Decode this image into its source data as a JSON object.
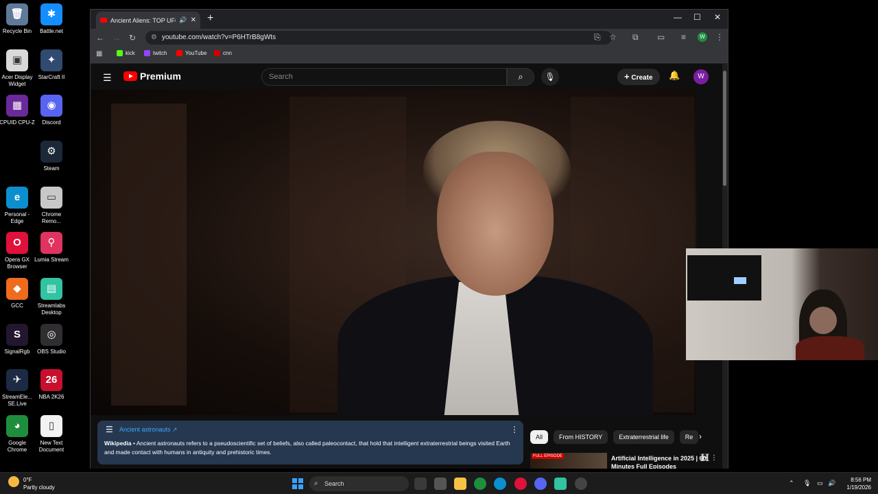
{
  "desktop": {
    "icons": [
      {
        "label": "Recycle Bin",
        "glyph": "🗑",
        "color": "#5f7a99"
      },
      {
        "label": "Battle.net",
        "glyph": "✱",
        "color": "#148eff"
      },
      {
        "label": "Acer Display Widget",
        "glyph": "▣",
        "color": "#d9d9d9"
      },
      {
        "label": "StarCraft II",
        "glyph": "✦",
        "color": "#304a70"
      },
      {
        "label": "CPUID CPU-Z",
        "glyph": "▦",
        "color": "#6a2a9a"
      },
      {
        "label": "Discord",
        "glyph": "◉",
        "color": "#5865f2"
      },
      {
        "label": "Steam",
        "glyph": "⚙",
        "color": "#1b2838"
      },
      {
        "label": "Personal - Edge",
        "glyph": "e",
        "color": "#0c8fce"
      },
      {
        "label": "Chrome Remo...",
        "glyph": "▭",
        "color": "#c8c8c8"
      },
      {
        "label": "Opera GX Browser",
        "glyph": "O",
        "color": "#e0113b"
      },
      {
        "label": "Lumia Stream",
        "glyph": "⚲",
        "color": "#e0335f"
      },
      {
        "label": "GCC",
        "glyph": "◆",
        "color": "#ef6b1d"
      },
      {
        "label": "Streamlabs Desktop",
        "glyph": "▤",
        "color": "#31c3a2"
      },
      {
        "label": "SignalRgb",
        "glyph": "S",
        "color": "#22172e"
      },
      {
        "label": "OBS Studio",
        "glyph": "◎",
        "color": "#302e31"
      },
      {
        "label": "StreamEle... SE.Live",
        "glyph": "✈",
        "color": "#1c2a44"
      },
      {
        "label": "NBA 2K26",
        "glyph": "26",
        "color": "#c8102e"
      },
      {
        "label": "Google Chrome",
        "glyph": "◕",
        "color": "#1e8e3e"
      },
      {
        "label": "New Text Document",
        "glyph": "▯",
        "color": "#f2f2f2"
      }
    ]
  },
  "browser": {
    "tab_title": "Ancient Aliens: TOP UFO M",
    "new_tab": "+",
    "url": "youtube.com/watch?v=P6HTrB8gWts",
    "profile_initial": "W",
    "bookmarks": [
      {
        "label": "kick",
        "color": "#53fc18"
      },
      {
        "label": "twitch",
        "color": "#9146ff"
      },
      {
        "label": "YouTube",
        "color": "#ff0000"
      },
      {
        "label": "cnn",
        "color": "#cc0000"
      }
    ]
  },
  "youtube": {
    "logo_text": "Premium",
    "search_placeholder": "Search",
    "create_label": "Create",
    "avatar_initial": "W",
    "watermark": "H",
    "info_panel": {
      "title": "Ancient astronauts ↗",
      "source": "Wikipedia",
      "text": " • Ancient astronauts refers to a pseudoscientific set of beliefs, also called paleocontact, that hold that intelligent extraterrestrial beings visited Earth and made contact with humans in antiquity and prehistoric times."
    },
    "chips": [
      "All",
      "From HISTORY",
      "Extraterrestrial life",
      "Re"
    ],
    "recommendation": {
      "badge": "FULL EPISODE",
      "title": "Artificial Intelligence in 2025 | 60 Minutes Full Episodes"
    }
  },
  "taskbar": {
    "temperature": "0°F",
    "weather": "Partly cloudy",
    "search_label": "Search",
    "time": "8:56 PM",
    "date": "1/19/2026"
  }
}
